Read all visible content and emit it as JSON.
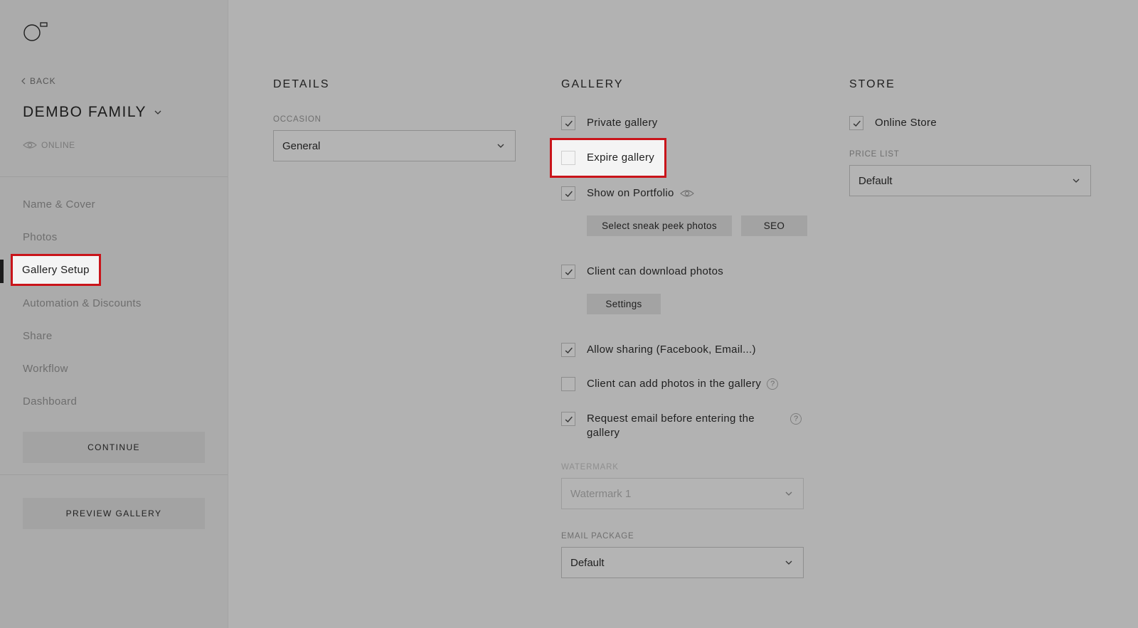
{
  "sidebar": {
    "back_label": "BACK",
    "gallery_name": "DEMBO FAMILY",
    "status_label": "ONLINE",
    "nav_items": [
      {
        "label": "Name & Cover"
      },
      {
        "label": "Photos"
      },
      {
        "label": "Gallery Setup"
      },
      {
        "label": "Automation & Discounts"
      },
      {
        "label": "Share"
      },
      {
        "label": "Workflow"
      },
      {
        "label": "Dashboard"
      }
    ],
    "active_item": "Gallery Setup",
    "continue_label": "CONTINUE",
    "preview_label": "PREVIEW GALLERY"
  },
  "details": {
    "title": "DETAILS",
    "occasion_label": "OCCASION",
    "occasion_value": "General"
  },
  "gallery": {
    "title": "GALLERY",
    "options": {
      "private_gallery": {
        "label": "Private gallery",
        "checked": true
      },
      "expire_gallery": {
        "label": "Expire gallery",
        "checked": false
      },
      "show_on_portfolio": {
        "label": "Show on Portfolio",
        "checked": true
      },
      "client_download": {
        "label": "Client can download photos",
        "checked": true
      },
      "allow_sharing": {
        "label": "Allow sharing (Facebook, Email...)",
        "checked": true
      },
      "client_add_photos": {
        "label": "Client can add photos in the gallery",
        "checked": false
      },
      "request_email": {
        "label_line1": "Request email before entering the",
        "label_line2": "gallery",
        "checked": true
      }
    },
    "sneak_peek_label": "Select sneak peek photos",
    "seo_label": "SEO",
    "settings_label": "Settings",
    "watermark_label": "WATERMARK",
    "watermark_value": "Watermark 1",
    "email_package_label": "EMAIL PACKAGE",
    "email_package_value": "Default"
  },
  "store": {
    "title": "STORE",
    "online_store": {
      "label": "Online Store",
      "checked": true
    },
    "price_list_label": "PRICE LIST",
    "price_list_value": "Default"
  },
  "colors": {
    "highlight": "#c9141a",
    "background": "#b2b2b2",
    "sidebar": "#ababab"
  }
}
